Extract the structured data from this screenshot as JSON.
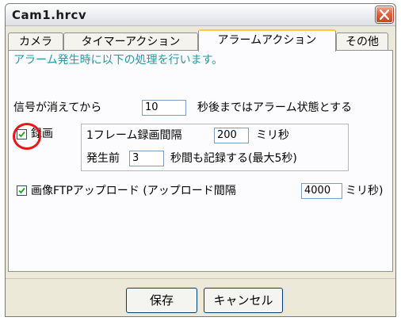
{
  "window": {
    "title": "Cam1.hrcv"
  },
  "tabs": [
    {
      "label": "カメラ"
    },
    {
      "label": "タイマーアクション"
    },
    {
      "label": "アラームアクション"
    },
    {
      "label": "その他"
    }
  ],
  "active_tab": "アラームアクション",
  "panel": {
    "description": "アラーム発生時に以下の処理を行います。",
    "signal_prefix": "信号が消えてから",
    "signal_value": "10",
    "signal_suffix": "秒後まではアラーム状態とする",
    "record": {
      "label": "録画",
      "checked": true,
      "interval_label": "1フレーム録画間隔",
      "interval_value": "200",
      "interval_unit": "ミリ秒",
      "pre_label": "発生前",
      "pre_value": "3",
      "pre_suffix": "秒間も記録する(最大5秒)"
    },
    "ftp": {
      "label": "画像FTPアップロード  (アップロード間隔",
      "checked": true,
      "interval_value": "4000",
      "interval_suffix": "ミリ秒)"
    }
  },
  "buttons": {
    "save": "保存",
    "cancel": "キャンセル"
  },
  "colors": {
    "info_text": "#1f9aa5",
    "highlight": "#e41818"
  }
}
